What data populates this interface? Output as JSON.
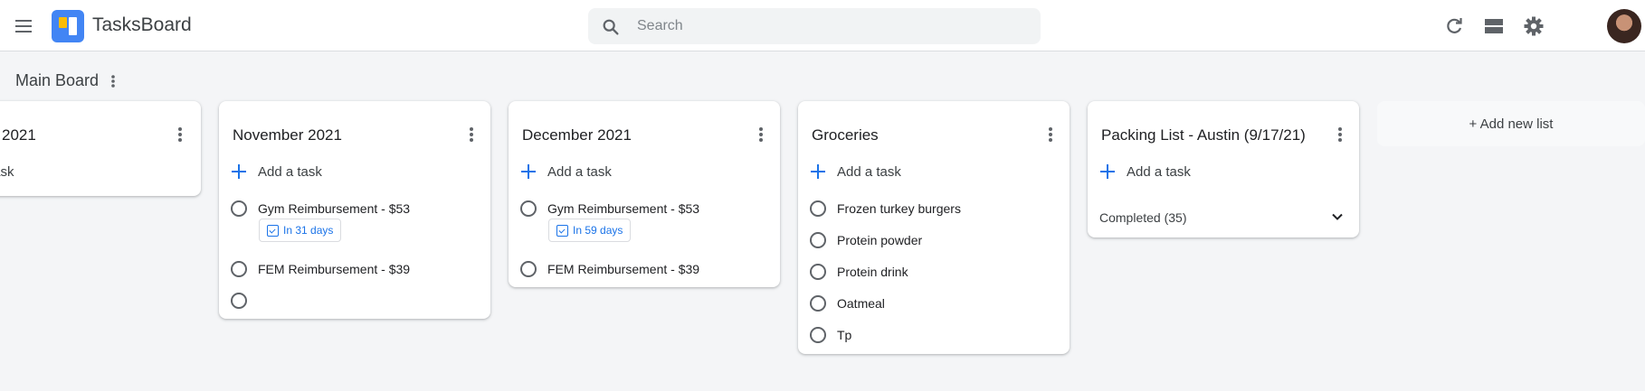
{
  "header": {
    "app_title": "TasksBoard",
    "search_placeholder": "Search",
    "search_value": ""
  },
  "board": {
    "title": "Main Board"
  },
  "lists": [
    {
      "title": "2021",
      "add_task_label": "task"
    },
    {
      "title": "November 2021",
      "add_task_label": "Add a task",
      "tasks": [
        {
          "label": "Gym Reimbursement - $53",
          "due": "In 31 days"
        },
        {
          "label": "FEM Reimbursement - $39"
        },
        {
          "label": ""
        }
      ]
    },
    {
      "title": "December 2021",
      "add_task_label": "Add a task",
      "tasks": [
        {
          "label": "Gym Reimbursement - $53",
          "due": "In 59 days"
        },
        {
          "label": "FEM Reimbursement - $39"
        }
      ]
    },
    {
      "title": "Groceries",
      "add_task_label": "Add a task",
      "tasks": [
        {
          "label": "Frozen turkey burgers"
        },
        {
          "label": "Protein powder"
        },
        {
          "label": "Protein drink"
        },
        {
          "label": "Oatmeal"
        },
        {
          "label": "Tp"
        }
      ]
    },
    {
      "title": "Packing List - Austin (9/17/21)",
      "add_task_label": "Add a task",
      "completed_label": "Completed (35)"
    }
  ],
  "add_list_label": "+ Add new list",
  "icons": {
    "menu": "menu-icon",
    "search": "search-icon",
    "refresh": "refresh-icon",
    "view": "view-toggle-icon",
    "settings": "gear-icon",
    "more": "more-vert-icon",
    "add": "plus-icon",
    "date": "calendar-icon",
    "expand": "chevron-down-icon"
  },
  "colors": {
    "accent": "#1a73e8",
    "logo_blue": "#4285f4",
    "logo_yellow": "#fbbc04",
    "background": "#f4f5f7"
  }
}
